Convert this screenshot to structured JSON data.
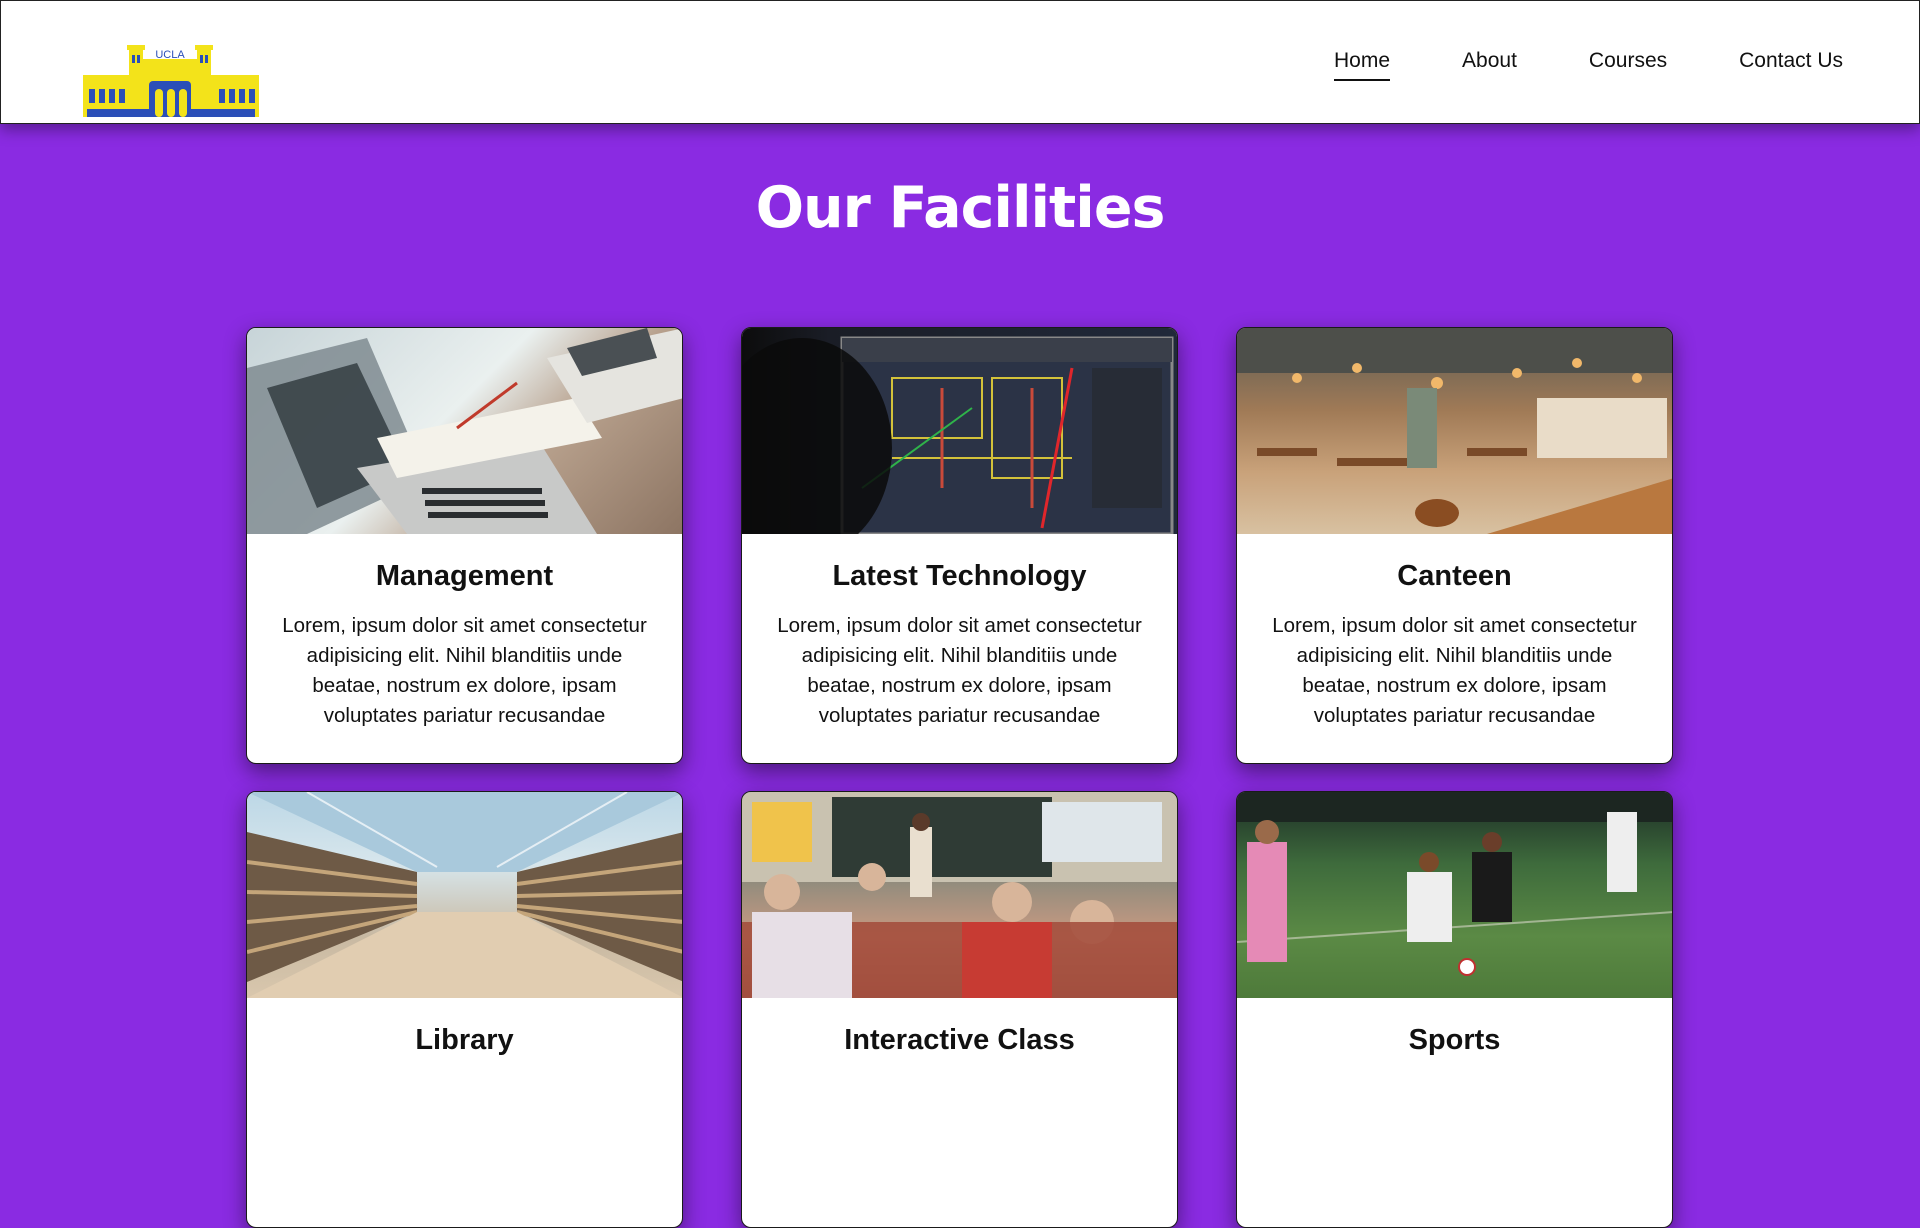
{
  "brand": {
    "logo_text": "UCLA",
    "logo_color": "#f3e31a",
    "logo_accent": "#2b4fb8"
  },
  "nav": {
    "items": [
      {
        "label": "Home",
        "active": true
      },
      {
        "label": "About",
        "active": false
      },
      {
        "label": "Courses",
        "active": false
      },
      {
        "label": "Contact Us",
        "active": false
      }
    ]
  },
  "section": {
    "title": "Our Facilities"
  },
  "cards": [
    {
      "title": "Management",
      "text": "Lorem, ipsum dolor sit amet consectetur adipisicing elit. Nihil blanditiis unde beatae, nostrum ex dolore, ipsam voluptates pariatur recusandae",
      "image": "laptop-paperwork-photo"
    },
    {
      "title": "Latest Technology",
      "text": "Lorem, ipsum dolor sit amet consectetur adipisicing elit. Nihil blanditiis unde beatae, nostrum ex dolore, ipsam voluptates pariatur recusandae",
      "image": "cad-monitor-photo"
    },
    {
      "title": "Canteen",
      "text": "Lorem, ipsum dolor sit amet consectetur adipisicing elit. Nihil blanditiis unde beatae, nostrum ex dolore, ipsam voluptates pariatur recusandae",
      "image": "restaurant-interior-photo"
    },
    {
      "title": "Library",
      "text": "",
      "image": "library-shelves-photo"
    },
    {
      "title": "Interactive Class",
      "text": "",
      "image": "classroom-photo"
    },
    {
      "title": "Sports",
      "text": "",
      "image": "soccer-match-photo"
    }
  ],
  "colors": {
    "background": "#8a2be2",
    "card": "#ffffff",
    "navbar": "#ffffff"
  }
}
